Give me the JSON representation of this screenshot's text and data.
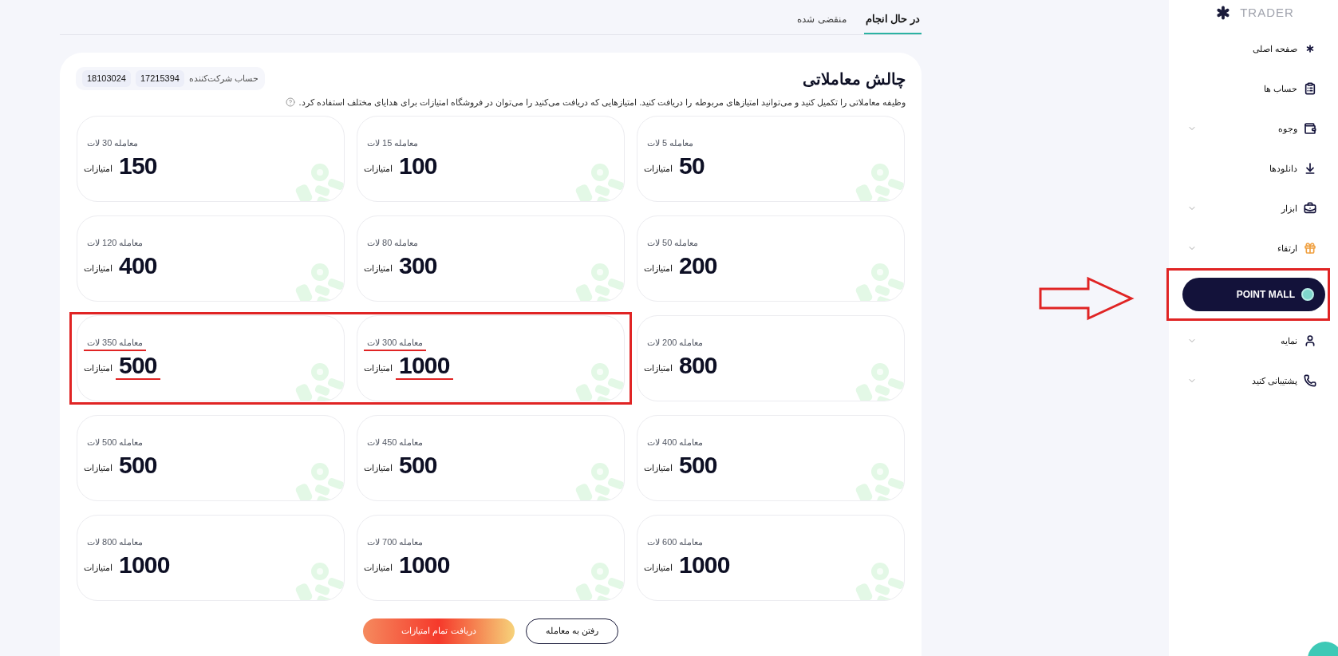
{
  "tabs": [
    {
      "label": "در حال انجام",
      "selected": true
    },
    {
      "label": "منقضی شده",
      "selected": false
    }
  ],
  "challenge": {
    "title": "چالش معاملاتی",
    "account_label": "حساب شرکت‌کننده",
    "accounts": [
      "17215394",
      "18103024"
    ],
    "description": "وظیفه معاملاتی را تکمیل کنید و می‌توانید امتیازهای مربوطه را دریافت کنید. امتیازهایی که دریافت می‌کنید را می‌توان در فروشگاه امتیازات برای هدایای مختلف استفاده کرد.",
    "tasks": [
      {
        "lots": "معامله 5 لات",
        "points": "50",
        "unit": "امتیازات",
        "highlighted": false
      },
      {
        "lots": "معامله 15 لات",
        "points": "100",
        "unit": "امتیازات",
        "highlighted": false
      },
      {
        "lots": "معامله 30 لات",
        "points": "150",
        "unit": "امتیازات",
        "highlighted": false
      },
      {
        "lots": "معامله 50 لات",
        "points": "200",
        "unit": "امتیازات",
        "highlighted": false
      },
      {
        "lots": "معامله 80 لات",
        "points": "300",
        "unit": "امتیازات",
        "highlighted": false
      },
      {
        "lots": "معامله 120 لات",
        "points": "400",
        "unit": "امتیازات",
        "highlighted": false
      },
      {
        "lots": "معامله 200 لات",
        "points": "800",
        "unit": "امتیازات",
        "highlighted": false
      },
      {
        "lots": "معامله 300 لات",
        "points": "1000",
        "unit": "امتیازات",
        "highlighted": true
      },
      {
        "lots": "معامله 350 لات",
        "points": "500",
        "unit": "امتیازات",
        "highlighted": true
      },
      {
        "lots": "معامله 400 لات",
        "points": "500",
        "unit": "امتیازات",
        "highlighted": false
      },
      {
        "lots": "معامله 450 لات",
        "points": "500",
        "unit": "امتیازات",
        "highlighted": false
      },
      {
        "lots": "معامله 500 لات",
        "points": "500",
        "unit": "امتیازات",
        "highlighted": false
      },
      {
        "lots": "معامله 600 لات",
        "points": "1000",
        "unit": "امتیازات",
        "highlighted": false
      },
      {
        "lots": "معامله 700 لات",
        "points": "1000",
        "unit": "امتیازات",
        "highlighted": false
      },
      {
        "lots": "معامله 800 لات",
        "points": "1000",
        "unit": "امتیازات",
        "highlighted": false
      }
    ],
    "buttons": [
      {
        "label": "رفتن به معامله",
        "kind": "outline"
      },
      {
        "label": "دریافت تمام امتیازات",
        "kind": "gradient"
      }
    ]
  },
  "sidebar": {
    "logo": "TRADER",
    "items": [
      {
        "label": "صفحه اصلی",
        "expandable": false,
        "selected": false,
        "annotated": false
      },
      {
        "label": "حساب ها",
        "expandable": false,
        "selected": false,
        "annotated": false
      },
      {
        "label": "وجوه",
        "expandable": true,
        "selected": false,
        "annotated": false
      },
      {
        "label": "دانلودها",
        "expandable": false,
        "selected": false,
        "annotated": false
      },
      {
        "label": "ابزار",
        "expandable": true,
        "selected": false,
        "annotated": false
      },
      {
        "label": "ارتقاء",
        "expandable": true,
        "selected": false,
        "annotated": false
      },
      {
        "label": "POINT MALL",
        "expandable": false,
        "selected": true,
        "annotated": true
      },
      {
        "label": "نمایه",
        "expandable": true,
        "selected": false,
        "annotated": false
      },
      {
        "label": "پشتیبانی کنید",
        "expandable": true,
        "selected": false,
        "annotated": false
      }
    ]
  }
}
